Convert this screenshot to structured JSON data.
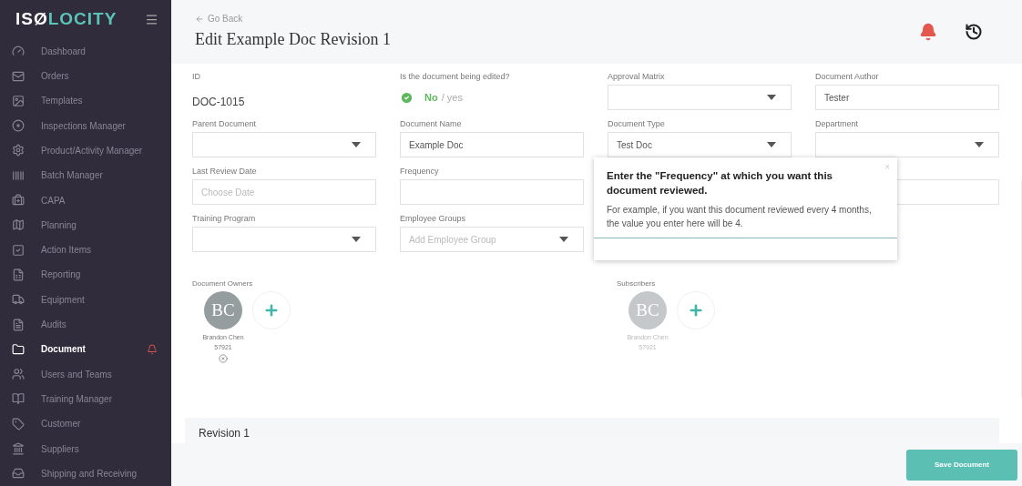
{
  "sidebar": {
    "logo": {
      "first": "ISØ",
      "second": "LOCITY"
    },
    "items": [
      {
        "label": "Dashboard",
        "selected": false,
        "alert": false
      },
      {
        "label": "Orders",
        "selected": false,
        "alert": false
      },
      {
        "label": "Templates",
        "selected": false,
        "alert": false
      },
      {
        "label": "Inspections Manager",
        "selected": false,
        "alert": false
      },
      {
        "label": "Product/Activity Manager",
        "selected": false,
        "alert": false
      },
      {
        "label": "Batch Manager",
        "selected": false,
        "alert": false
      },
      {
        "label": "CAPA",
        "selected": false,
        "alert": false
      },
      {
        "label": "Planning",
        "selected": false,
        "alert": false
      },
      {
        "label": "Action Items",
        "selected": false,
        "alert": false
      },
      {
        "label": "Reporting",
        "selected": false,
        "alert": false
      },
      {
        "label": "Equipment",
        "selected": false,
        "alert": false
      },
      {
        "label": "Audits",
        "selected": false,
        "alert": false
      },
      {
        "label": "Document",
        "selected": true,
        "alert": true
      },
      {
        "label": "Users and Teams",
        "selected": false,
        "alert": false
      },
      {
        "label": "Training Manager",
        "selected": false,
        "alert": false
      },
      {
        "label": "Customer",
        "selected": false,
        "alert": false
      },
      {
        "label": "Suppliers",
        "selected": false,
        "alert": false
      },
      {
        "label": "Shipping and Receiving",
        "selected": false,
        "alert": false
      }
    ]
  },
  "header": {
    "back": "Go Back",
    "title": "Edit Example Doc Revision 1"
  },
  "form_rows": [
    [
      {
        "kind": "static",
        "label": "ID",
        "value": "DOC-1015"
      },
      {
        "kind": "toggle",
        "label": "Is the document being edited?",
        "on": false,
        "options": [
          "No",
          "/ yes"
        ]
      },
      {
        "kind": "select",
        "label": "Approval Matrix"
      },
      {
        "kind": "text",
        "label": "Document Author",
        "value": "Tester"
      }
    ],
    [
      {
        "kind": "select",
        "label": "Parent Document"
      },
      {
        "kind": "text",
        "label": "Document Name",
        "value": "Example Doc"
      },
      {
        "kind": "select",
        "label": "Document Type",
        "value": "Test Doc"
      },
      {
        "kind": "select",
        "label": "Department"
      }
    ],
    [
      {
        "kind": "text",
        "label": "Last Review Date",
        "placeholder": "Choose Date"
      },
      {
        "kind": "text",
        "label": "Frequency"
      },
      {
        "kind": "covered"
      },
      {
        "kind": "text"
      }
    ],
    [
      {
        "kind": "select",
        "label": "Training Program"
      },
      {
        "kind": "select",
        "label": "Employee Groups",
        "placeholder": "Add Employee Group"
      }
    ]
  ],
  "people_groups": [
    {
      "label": "Document Owners",
      "people": [
        {
          "initials": "BC",
          "name": "Brandon Chen",
          "number": "57921",
          "disabled": false,
          "removable": true
        }
      ]
    },
    {
      "label": "Subscribers",
      "people": [
        {
          "initials": "BC",
          "name": "Brandon Chen",
          "number": "57921",
          "disabled": true,
          "removable": false
        }
      ]
    }
  ],
  "revision": {
    "title": "Revision 1"
  },
  "popover": {
    "title": "Enter the \"Frequency\" at which you want this document reviewed.",
    "body": "For example, if you want this document reviewed every 4 months, the value you enter here will be 4.",
    "close": "×"
  },
  "footer": {
    "save": "Save Document"
  }
}
